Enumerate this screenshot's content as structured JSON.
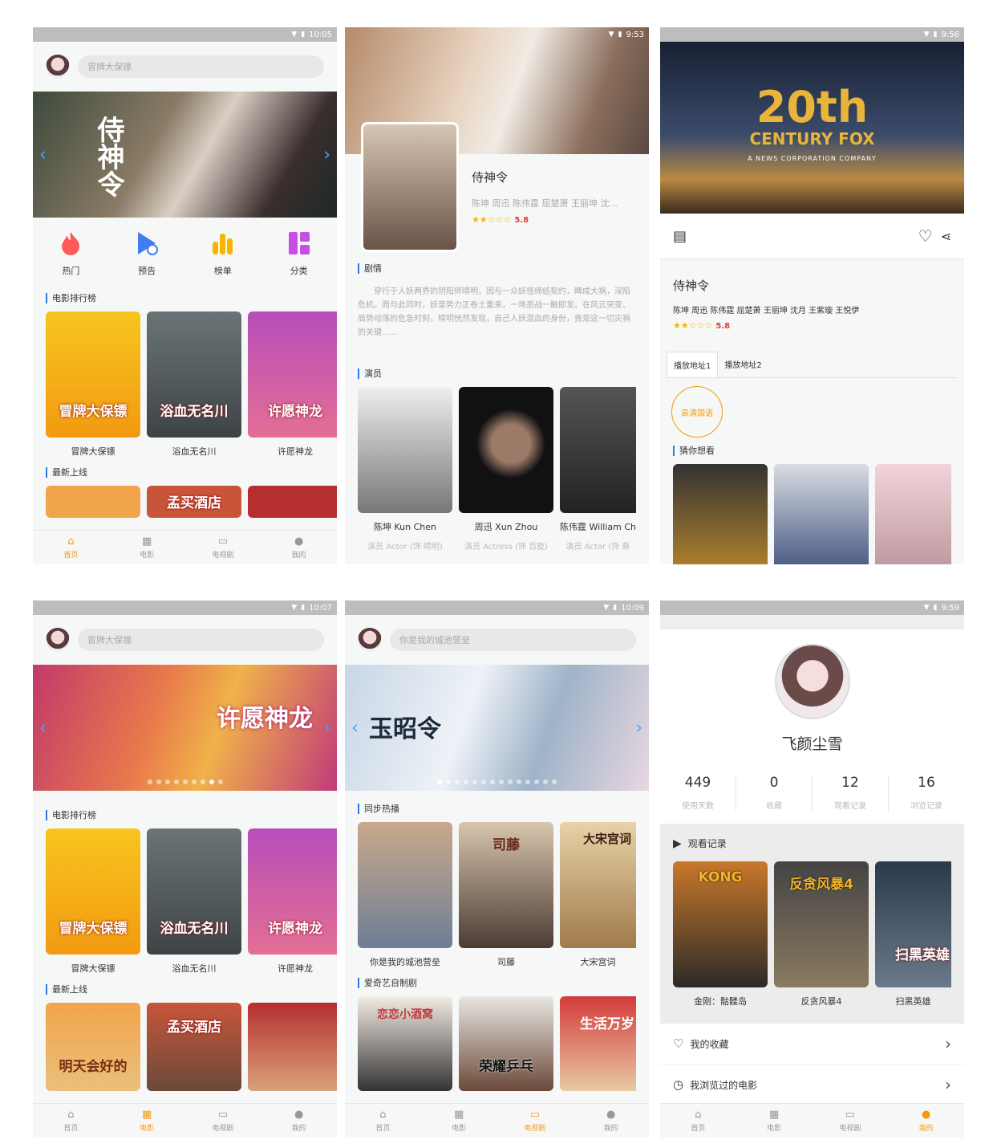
{
  "p1": {
    "time": "10:05",
    "search_placeholder": "冒牌大保镖",
    "quick": [
      {
        "label": "热门",
        "icon": "fire-icon",
        "color": "#ff5a5a"
      },
      {
        "label": "预告",
        "icon": "trailer-icon",
        "color": "#3f7df0"
      },
      {
        "label": "榜单",
        "icon": "chart-icon",
        "color": "#f7b500"
      },
      {
        "label": "分类",
        "icon": "category-icon",
        "color": "#c64fe8"
      }
    ],
    "section_rank": "电影排行榜",
    "rank": [
      {
        "title": "冒牌大保镖",
        "poster_text": "冒牌大保镖"
      },
      {
        "title": "浴血无名川",
        "poster_text": "浴血无名川"
      },
      {
        "title": "许愿神龙",
        "poster_text": "许愿神龙"
      }
    ],
    "section_new": "最新上线",
    "new_posters": [
      "",
      "孟买酒店",
      ""
    ]
  },
  "p2": {
    "time": "9:53",
    "title": "侍神令",
    "cast_line": "陈坤 周迅 陈伟霆 屈楚萧 王丽坤 沈...",
    "rating": "5.8",
    "section_plot": "剧情",
    "plot": "穿行于人妖两界的阴阳师晴明，因与一众妖怪缔结契约，睥成大祸，深陷危机。而与此同时，妖皇势力正卷土重来，一场恶战一触即发。在风云突变、局势动荡的危急时刻，晴明恍然发现，自己人妖混血的身份，竟是这一切灾祸的关键......",
    "section_cast": "演员",
    "actors": [
      {
        "name": "陈坤 Kun Chen",
        "role": "演员 Actor (饰 晴明)"
      },
      {
        "name": "周迅 Xun Zhou",
        "role": "演员 Actress (饰 百旋)"
      },
      {
        "name": "陈伟霆 William Ch",
        "role": "演员 Actor (饰 蔡"
      }
    ]
  },
  "p3": {
    "time": "9:56",
    "logo_big": "20th",
    "logo_sub": "CENTURY FOX",
    "logo_tag": "A NEWS CORPORATION COMPANY",
    "title": "侍神令",
    "cast_line": "陈坤 周迅 陈伟霆 屈楚萧 王丽坤 沈月 王紫璇 王悦伊",
    "rating": "5.8",
    "tabs": [
      "播放地址1",
      "播放地址2"
    ],
    "source_label": "高清国语",
    "section_guess": "猜你想看"
  },
  "p4": {
    "time": "10:07",
    "search_placeholder": "冒牌大保镖",
    "section_rank": "电影排行榜",
    "rank": [
      {
        "title": "冒牌大保镖",
        "poster_text": "冒牌大保镖"
      },
      {
        "title": "浴血无名川",
        "poster_text": "浴血无名川"
      },
      {
        "title": "许愿神龙",
        "poster_text": "许愿神龙"
      }
    ],
    "banner_text": "许愿神龙",
    "section_new": "最新上线",
    "new_posters": [
      "明天会好的",
      "孟买酒店",
      ""
    ]
  },
  "p5": {
    "time": "10:09",
    "search_placeholder": "你是我的城池营垒",
    "banner_text": "玉昭令",
    "section_hot": "同步热播",
    "hot": [
      {
        "title": "你是我的城池营垒",
        "poster_text": ""
      },
      {
        "title": "司藤",
        "poster_text": "司藤"
      },
      {
        "title": "大宋宫词",
        "poster_text": "大宋宫词"
      }
    ],
    "section_own": "爱奇艺自制剧",
    "own_posters": [
      "恋恋小酒窝",
      "荣耀乒乓",
      "生活万岁"
    ]
  },
  "p6": {
    "time": "9:59",
    "username": "飞颜尘雪",
    "stats": [
      {
        "n": "449",
        "l": "使用天数"
      },
      {
        "n": "0",
        "l": "收藏"
      },
      {
        "n": "12",
        "l": "观看记录"
      },
      {
        "n": "16",
        "l": "浏览记录"
      }
    ],
    "history_title": "观看记录",
    "history": [
      {
        "title": "金刚：骷髅岛",
        "poster_text": "KONG"
      },
      {
        "title": "反贪风暴4",
        "poster_text": "反贪风暴4"
      },
      {
        "title": "扫黑英雄",
        "poster_text": "扫黑英雄"
      }
    ],
    "menu_fav": "我的收藏",
    "menu_browse": "我浏览过的电影"
  },
  "nav": [
    "首页",
    "电影",
    "电视剧",
    "我的"
  ],
  "colors": {
    "accent": "#f59a10",
    "section_bar": "#2a7be4",
    "star": "#f5b301",
    "rating": "#e53935"
  }
}
